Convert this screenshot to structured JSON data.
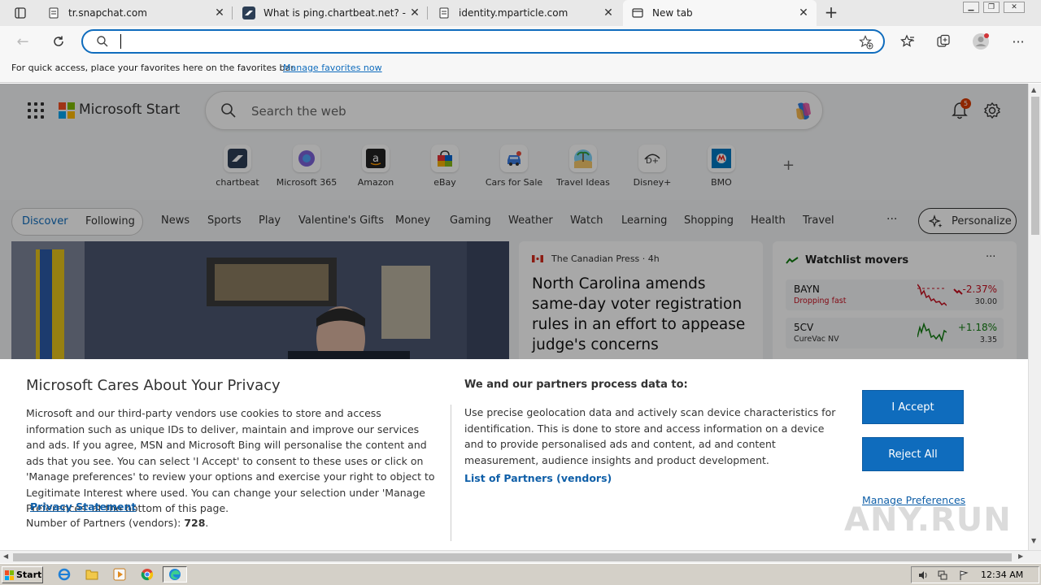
{
  "browser": {
    "tabs": [
      {
        "title": "tr.snapchat.com",
        "active": false,
        "icon": "snapchat-doc-icon"
      },
      {
        "title": "What is ping.chartbeat.net? - cha",
        "active": false,
        "icon": "chartbeat-icon"
      },
      {
        "title": "identity.mparticle.com",
        "active": false,
        "icon": "mparticle-doc-icon"
      },
      {
        "title": "New tab",
        "active": true,
        "icon": "new-tab-icon"
      }
    ],
    "address_value": "",
    "favorites_bar": {
      "message": "For quick access, place your favorites here on the favorites bar.",
      "link": "Manage favorites now"
    }
  },
  "start_page": {
    "brand": "Microsoft Start",
    "search_placeholder": "Search the web",
    "notification_count": "5",
    "quick_links": [
      {
        "label": "chartbeat",
        "icon": "chartbeat-icon"
      },
      {
        "label": "Microsoft 365",
        "icon": "microsoft-365-icon"
      },
      {
        "label": "Amazon",
        "icon": "amazon-icon"
      },
      {
        "label": "eBay",
        "icon": "ebay-icon"
      },
      {
        "label": "Cars for Sale",
        "icon": "car-icon"
      },
      {
        "label": "Travel Ideas",
        "icon": "beach-icon"
      },
      {
        "label": "Disney+",
        "icon": "disney-plus-icon"
      },
      {
        "label": "BMO",
        "icon": "bmo-icon"
      }
    ],
    "feed_toggle": {
      "discover": "Discover",
      "following": "Following"
    },
    "nav": [
      "News",
      "Sports",
      "Play",
      "Valentine's Gifts",
      "Money",
      "Gaming",
      "Weather",
      "Watch",
      "Learning",
      "Shopping",
      "Health",
      "Travel"
    ],
    "more": "···",
    "personalize": "Personalize",
    "story": {
      "source": "The Canadian Press · 4h",
      "headline": "North Carolina amends same-day voter registration rules in an effort to appease judge's concerns"
    },
    "watchlist": {
      "title": "Watchlist movers",
      "more": "···",
      "stocks": [
        {
          "symbol": "BAYN",
          "sub": "Dropping fast",
          "change": "-2.37%",
          "price": "30.00",
          "direction": "down"
        },
        {
          "symbol": "5CV",
          "sub": "CureVac NV",
          "change": "+1.18%",
          "price": "3.35",
          "direction": "up"
        }
      ]
    }
  },
  "privacy": {
    "title": "Microsoft Cares About Your Privacy",
    "body": "Microsoft and our third-party vendors use cookies to store and access information such as unique IDs to deliver, maintain and improve our services and ads. If you agree, MSN and Microsoft Bing will personalise the content and ads that you see. You can select 'I Accept' to consent to these uses or click on 'Manage preferences' to review your options and exercise your right to object to Legitimate Interest where used.  You can change your selection under 'Manage Preferences' at the bottom of this page.",
    "privacy_link": "Privacy Statement",
    "partners_label": "Number of Partners (vendors):",
    "partners_count": "728",
    "right_title": "We and our partners process data to:",
    "right_body": "Use precise geolocation data and actively scan device characteristics for identification. This is done to store and access information on a device and to provide personalised ads and content, ad and content measurement, audience insights and product development.",
    "vendors_link": "List of Partners (vendors)",
    "accept": "I Accept",
    "reject": "Reject All",
    "manage": "Manage Preferences"
  },
  "watermark": "ANY.RUN",
  "taskbar": {
    "start": "Start",
    "apps": [
      "ie-icon",
      "folder-icon",
      "media-player-icon",
      "chrome-icon",
      "edge-icon"
    ],
    "clock": "12:34 AM"
  },
  "colors": {
    "accent": "#0f6cbd",
    "link": "#0f5fa8",
    "negative": "#c50f1f",
    "positive": "#107c10"
  }
}
